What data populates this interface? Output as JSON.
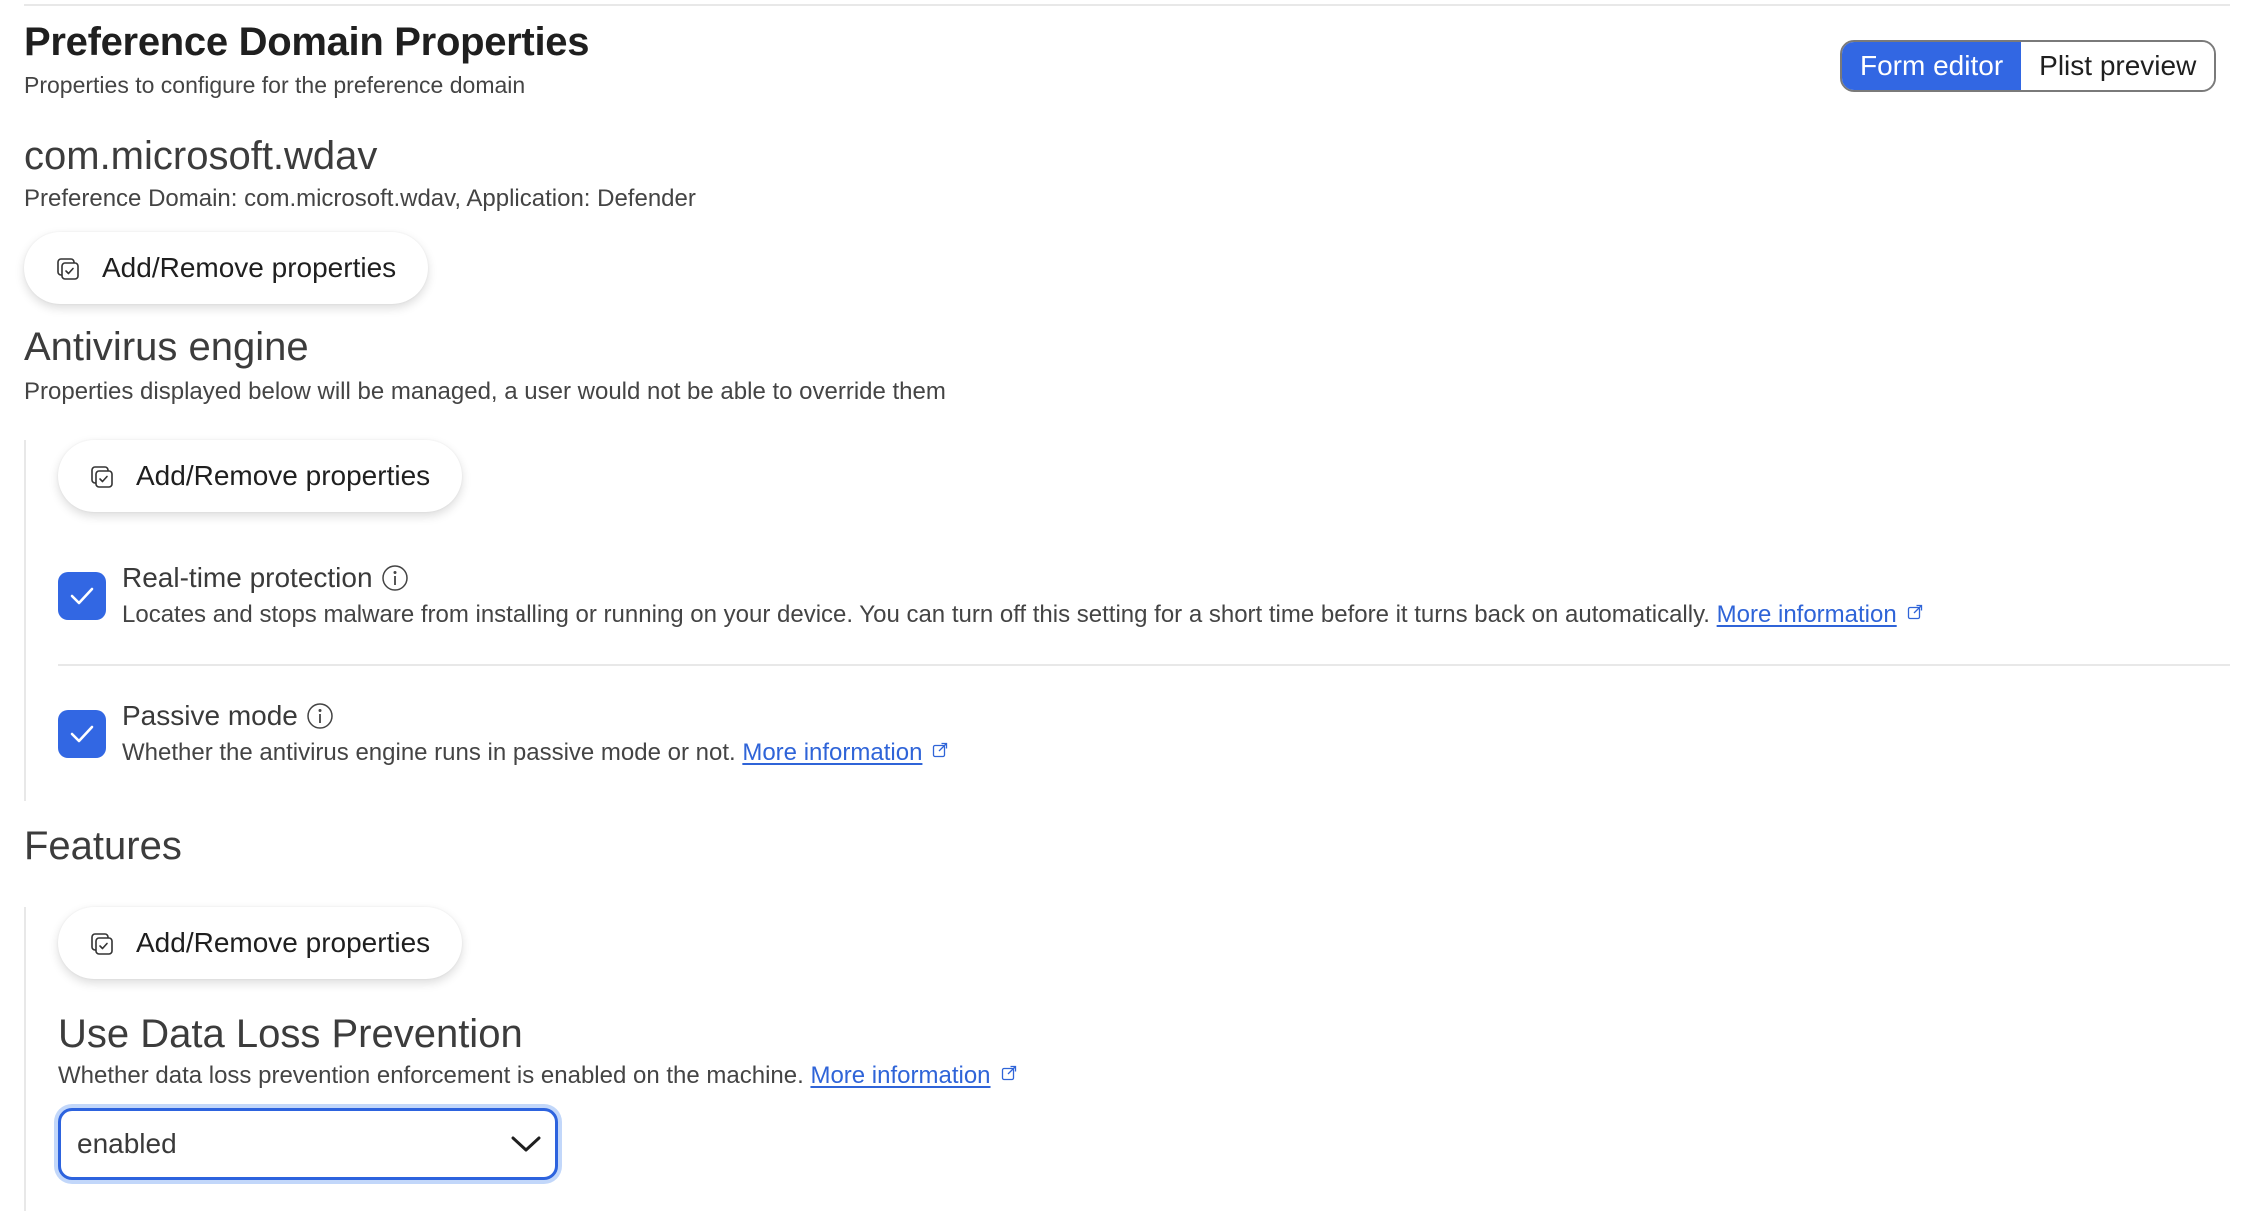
{
  "header": {
    "title": "Preference Domain Properties",
    "subtitle": "Properties to configure for the preference domain"
  },
  "view_toggle": {
    "options": [
      {
        "label": "Form editor",
        "active": true
      },
      {
        "label": "Plist preview",
        "active": false
      }
    ]
  },
  "domain": {
    "name": "com.microsoft.wdav",
    "meta": "Preference Domain: com.microsoft.wdav, Application: Defender",
    "add_remove_label": "Add/Remove properties"
  },
  "sections": [
    {
      "title": "Antivirus engine",
      "description": "Properties displayed below will be managed, a user would not be able to override them",
      "add_remove_label": "Add/Remove properties",
      "properties": [
        {
          "label": "Real-time protection",
          "checked": true,
          "description": "Locates and stops malware from installing or running on your device. You can turn off this setting for a short time before it turns back on automatically.",
          "link_label": "More information",
          "icon": "info-icon"
        },
        {
          "label": "Passive mode",
          "checked": true,
          "description": "Whether the antivirus engine runs in passive mode or not.",
          "link_label": "More information",
          "icon": "info-icon"
        }
      ]
    },
    {
      "title": "Features",
      "add_remove_label": "Add/Remove properties",
      "properties": [
        {
          "label": "Use Data Loss Prevention",
          "description": "Whether data loss prevention enforcement is enabled on the machine.",
          "link_label": "More information",
          "select_value": "enabled"
        }
      ]
    }
  ],
  "colors": {
    "accent": "#3267e3",
    "link": "#2f64d8",
    "divider": "#e8e8e8"
  }
}
